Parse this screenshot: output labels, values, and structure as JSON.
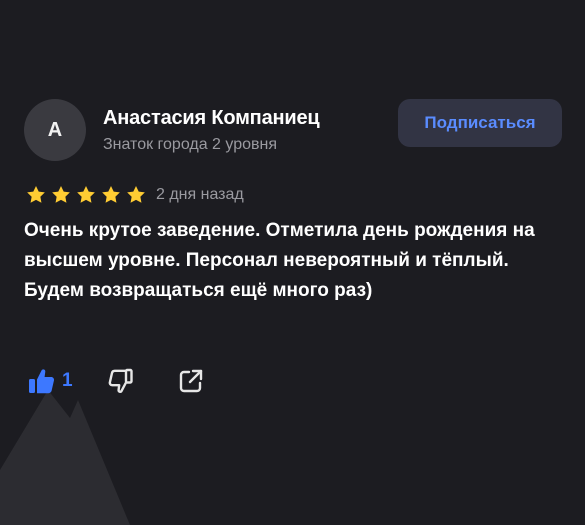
{
  "review": {
    "avatar_letter": "А",
    "author_name": "Анастасия Компаниец",
    "author_level": "Знаток города 2 уровня",
    "subscribe_label": "Подписаться",
    "rating": 5,
    "rating_max": 5,
    "date": "2 дня назад",
    "text": "Очень крутое заведение. Отметила день рождения на высшем уровне. Персонал невероятный и тёплый. Будем возвращаться ещё много раз)",
    "likes": "1"
  },
  "colors": {
    "background": "#1c1c21",
    "accent_blue": "#3d78ff",
    "star": "#ffcc33",
    "muted_text": "#9a9aa0",
    "button_bg": "#323444"
  },
  "icons": {
    "like": "thumbs-up-icon",
    "dislike": "thumbs-down-icon",
    "share": "share-icon",
    "star": "star-icon"
  }
}
